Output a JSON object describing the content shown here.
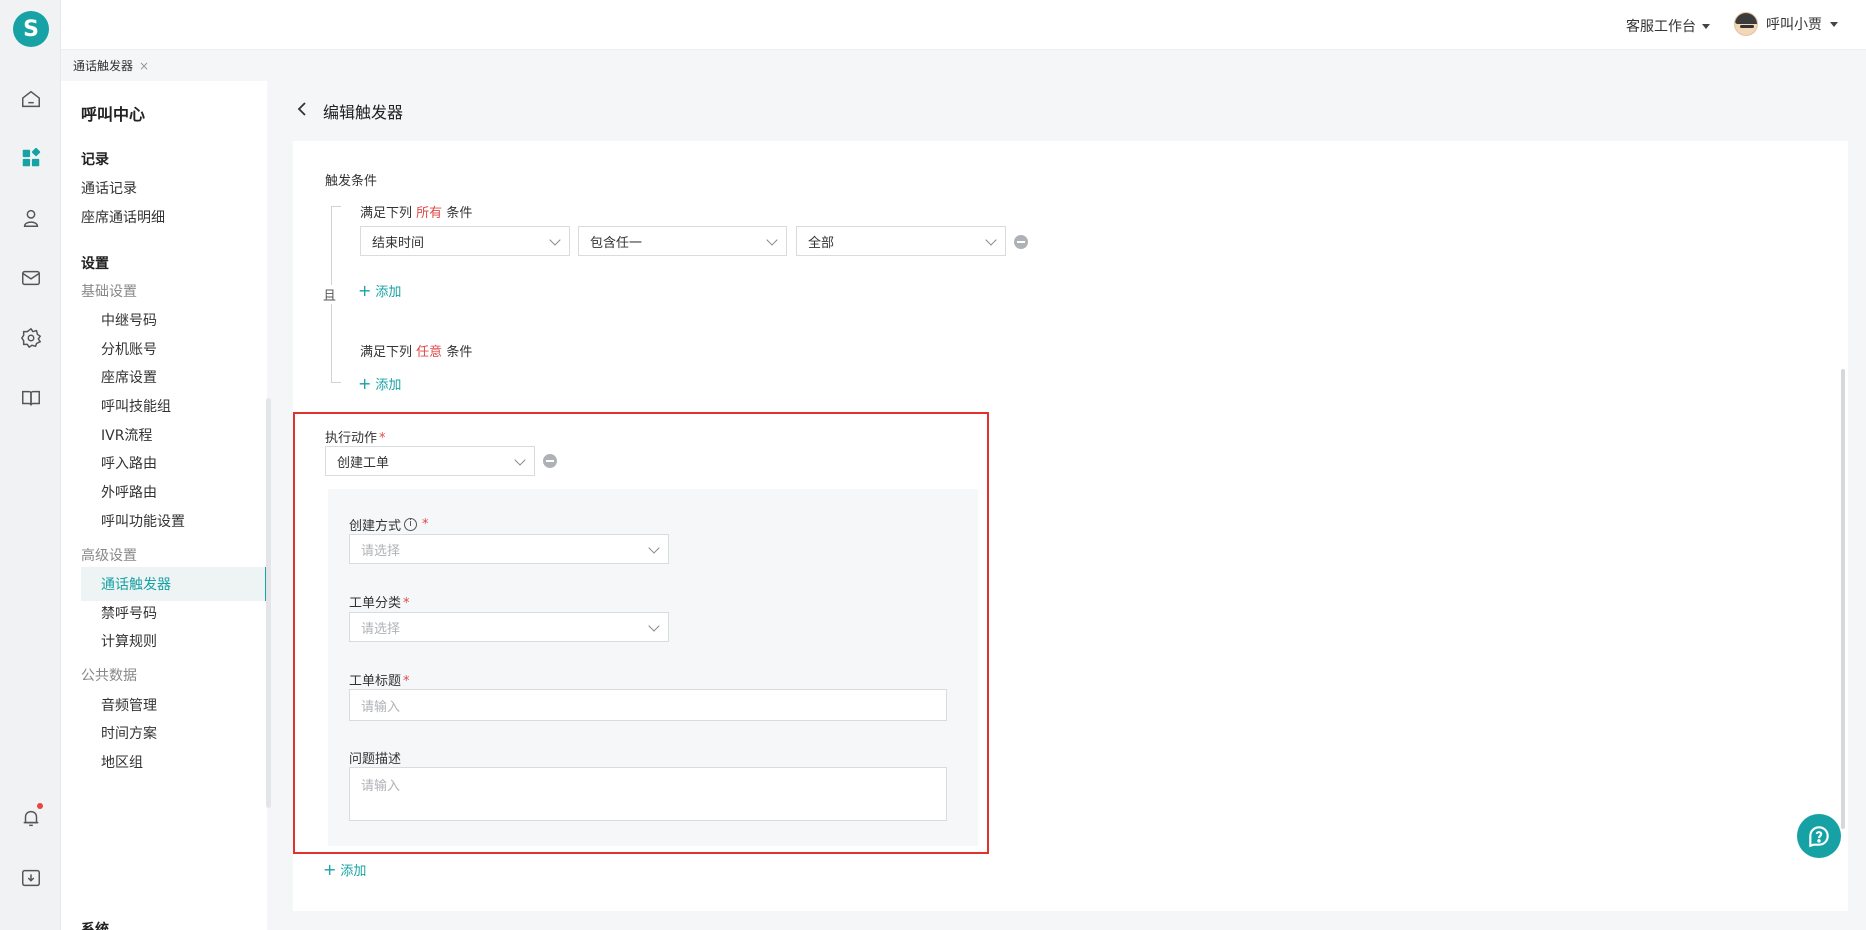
{
  "app": {
    "logo": "S",
    "workspace": "客服工作台",
    "user": "呼叫小贾"
  },
  "tab": {
    "label": "通话触发器",
    "close": "×"
  },
  "sidebar": {
    "title": "呼叫中心",
    "sections": {
      "records": "记录",
      "settings": "设置",
      "system": "系统"
    },
    "records": [
      "通话记录",
      "座席通话明细"
    ],
    "groups": {
      "basic": "基础设置",
      "advanced": "高级设置",
      "public": "公共数据"
    },
    "basic_items": [
      "中继号码",
      "分机账号",
      "座席设置",
      "呼叫技能组",
      "IVR流程",
      "呼入路由",
      "外呼路由",
      "呼叫功能设置"
    ],
    "advanced_items": [
      "通话触发器",
      "禁呼号码",
      "计算规则"
    ],
    "public_items": [
      "音频管理",
      "时间方案",
      "地区组"
    ]
  },
  "page": {
    "title": "编辑触发器"
  },
  "trigger": {
    "section_label": "触发条件",
    "all_prefix": "满足下列",
    "all_word": "所有",
    "all_suffix": "条件",
    "any_prefix": "满足下列",
    "any_word": "任意",
    "any_suffix": "条件",
    "connector": "且",
    "cond": {
      "field": "结束时间",
      "op": "包含任一",
      "value": "全部"
    },
    "add_label": "添加"
  },
  "action": {
    "label": "执行动作",
    "required_mark": "*",
    "value": "创建工单",
    "create_mode_label": "创建方式",
    "create_mode_placeholder": "请选择",
    "category_label": "工单分类",
    "category_placeholder": "请选择",
    "title_label": "工单标题",
    "title_placeholder": "请输入",
    "desc_label": "问题描述",
    "desc_placeholder": "请输入",
    "add_label": "添加"
  },
  "icons": {
    "rail": [
      "home-icon",
      "apps-icon",
      "contacts-icon",
      "mail-icon",
      "gear-icon",
      "book-icon",
      "bell-icon",
      "download-icon"
    ],
    "help": "help-bubble-icon"
  },
  "colors": {
    "accent": "#17a2a5",
    "highlight": "#e0322e",
    "required": "#e04848"
  }
}
